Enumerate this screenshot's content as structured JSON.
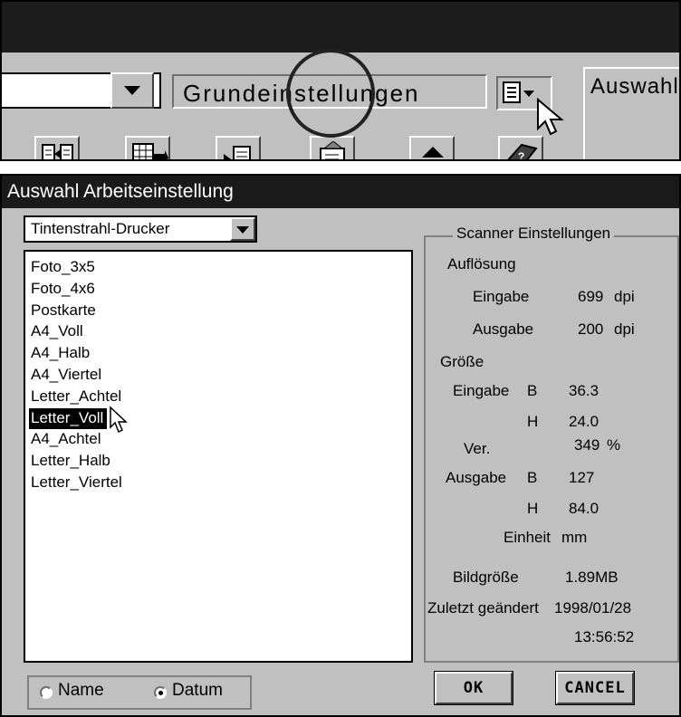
{
  "toolbar": {
    "setting_field": "Grundeinstellungen",
    "right_panel_label": "Auswahl",
    "buttons": [
      "toolbar-btn-1",
      "toolbar-btn-2",
      "toolbar-btn-3",
      "toolbar-btn-4",
      "eject",
      "toolbar-btn-6"
    ]
  },
  "dialog": {
    "title": "Auswahl Arbeitseinstellung",
    "printer_select": "Tintenstrahl-Drucker",
    "list_items": [
      "Foto_3x5",
      "Foto_4x6",
      "Postkarte",
      "A4_Voll",
      "A4_Halb",
      "A4_Viertel",
      "Letter_Achtel",
      "Letter_Voll",
      "A4_Achtel",
      "Letter_Halb",
      "Letter_Viertel"
    ],
    "selected_item": "Letter_Voll",
    "sort": {
      "name_label": "Name",
      "date_label": "Datum",
      "selected": "Datum"
    },
    "ok_label": "OK",
    "cancel_label": "CANCEL"
  },
  "scanner": {
    "group_title": "Scanner Einstellungen",
    "resolution_label": "Auflösung",
    "res_input_label": "Eingabe",
    "res_input_value": "699",
    "res_input_unit": "dpi",
    "res_output_label": "Ausgabe",
    "res_output_value": "200",
    "res_output_unit": "dpi",
    "size_label": "Größe",
    "size_input_label": "Eingabe",
    "b_label": "B",
    "h_label": "H",
    "size_input_b": "36.3",
    "size_input_h": "24.0",
    "ver_label": "Ver.",
    "ver_value": "349",
    "ver_unit": "%",
    "size_output_label": "Ausgabe",
    "size_output_b": "127",
    "size_output_h": "84.0",
    "unit_label": "Einheit",
    "unit_value": "mm",
    "imagesize_label": "Bildgröße",
    "imagesize_value": "1.89MB",
    "changed_label": "Zuletzt geändert",
    "changed_date": "1998/01/28",
    "changed_time": "13:56:52"
  }
}
